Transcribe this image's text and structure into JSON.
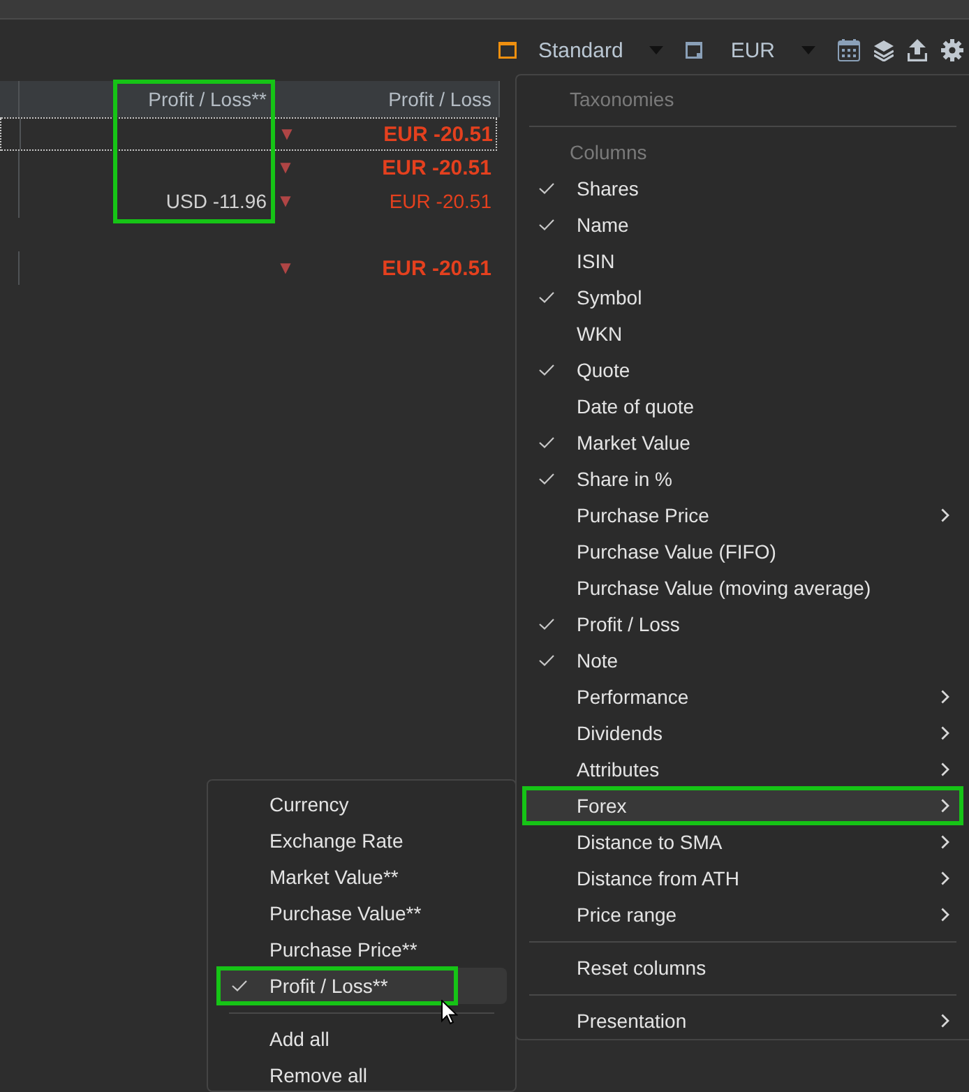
{
  "toolbar": {
    "view": "Standard",
    "currency": "EUR"
  },
  "table": {
    "columns": [
      {
        "label": "Profit / Loss**",
        "annotated": true
      },
      {
        "label": "Profit / Loss"
      }
    ],
    "rows": [
      {
        "kind": "data",
        "marker": "▼",
        "profit_loss": "EUR -20.51",
        "bold": true,
        "focused": true
      },
      {
        "kind": "data",
        "marker": "▼",
        "profit_loss": "EUR -20.51",
        "bold": true,
        "focused": false
      },
      {
        "kind": "data",
        "profit_loss_forex": "USD -11.96",
        "marker": "▼",
        "profit_loss": "EUR -20.51",
        "bold": false,
        "focused": false
      },
      {
        "kind": "blank"
      },
      {
        "kind": "data",
        "marker": "▼",
        "profit_loss": "EUR -20.51",
        "bold": true,
        "focused": false
      }
    ]
  },
  "menu": {
    "items": [
      {
        "kind": "header",
        "label": "Taxonomies"
      },
      {
        "kind": "separator"
      },
      {
        "kind": "header",
        "label": "Columns"
      },
      {
        "kind": "item",
        "label": "Shares",
        "checked": true,
        "submenu": false,
        "selected": false
      },
      {
        "kind": "item",
        "label": "Name",
        "checked": true,
        "submenu": false,
        "selected": false
      },
      {
        "kind": "item",
        "label": "ISIN",
        "checked": false,
        "submenu": false,
        "selected": false
      },
      {
        "kind": "item",
        "label": "Symbol",
        "checked": true,
        "submenu": false,
        "selected": false
      },
      {
        "kind": "item",
        "label": "WKN",
        "checked": false,
        "submenu": false,
        "selected": false
      },
      {
        "kind": "item",
        "label": "Quote",
        "checked": true,
        "submenu": false,
        "selected": false
      },
      {
        "kind": "item",
        "label": "Date of quote",
        "checked": false,
        "submenu": false,
        "selected": false
      },
      {
        "kind": "item",
        "label": "Market Value",
        "checked": true,
        "submenu": false,
        "selected": false
      },
      {
        "kind": "item",
        "label": "Share in %",
        "checked": true,
        "submenu": false,
        "selected": false
      },
      {
        "kind": "item",
        "label": "Purchase Price",
        "checked": false,
        "submenu": true,
        "selected": false
      },
      {
        "kind": "item",
        "label": "Purchase Value (FIFO)",
        "checked": false,
        "submenu": false,
        "selected": false
      },
      {
        "kind": "item",
        "label": "Purchase Value (moving average)",
        "checked": false,
        "submenu": false,
        "selected": false
      },
      {
        "kind": "item",
        "label": "Profit / Loss",
        "checked": true,
        "submenu": false,
        "selected": false
      },
      {
        "kind": "item",
        "label": "Note",
        "checked": true,
        "submenu": false,
        "selected": false
      },
      {
        "kind": "item",
        "label": "Performance",
        "checked": false,
        "submenu": true,
        "selected": false
      },
      {
        "kind": "item",
        "label": "Dividends",
        "checked": false,
        "submenu": true,
        "selected": false
      },
      {
        "kind": "item",
        "label": "Attributes",
        "checked": false,
        "submenu": true,
        "selected": false
      },
      {
        "kind": "item",
        "label": "Forex",
        "checked": false,
        "submenu": true,
        "selected": true,
        "annotated": true
      },
      {
        "kind": "item",
        "label": "Distance to SMA",
        "checked": false,
        "submenu": true,
        "selected": false
      },
      {
        "kind": "item",
        "label": "Distance from ATH",
        "checked": false,
        "submenu": true,
        "selected": false
      },
      {
        "kind": "item",
        "label": "Price range",
        "checked": false,
        "submenu": true,
        "selected": false
      },
      {
        "kind": "separator"
      },
      {
        "kind": "item",
        "label": "Reset columns",
        "checked": false,
        "submenu": false,
        "selected": false
      },
      {
        "kind": "separator"
      },
      {
        "kind": "item",
        "label": "Presentation",
        "checked": false,
        "submenu": true,
        "selected": false
      }
    ]
  },
  "submenu": {
    "items": [
      {
        "kind": "item",
        "label": "Currency",
        "checked": false,
        "selected": false
      },
      {
        "kind": "item",
        "label": "Exchange Rate",
        "checked": false,
        "selected": false
      },
      {
        "kind": "item",
        "label": "Market Value**",
        "checked": false,
        "selected": false
      },
      {
        "kind": "item",
        "label": "Purchase Value**",
        "checked": false,
        "selected": false
      },
      {
        "kind": "item",
        "label": "Purchase Price**",
        "checked": false,
        "selected": false
      },
      {
        "kind": "item",
        "label": "Profit / Loss**",
        "checked": true,
        "selected": true,
        "annotated": true
      },
      {
        "kind": "separator"
      },
      {
        "kind": "item",
        "label": "Add all",
        "checked": false,
        "selected": false
      },
      {
        "kind": "item",
        "label": "Remove all",
        "checked": false,
        "selected": false
      }
    ]
  }
}
